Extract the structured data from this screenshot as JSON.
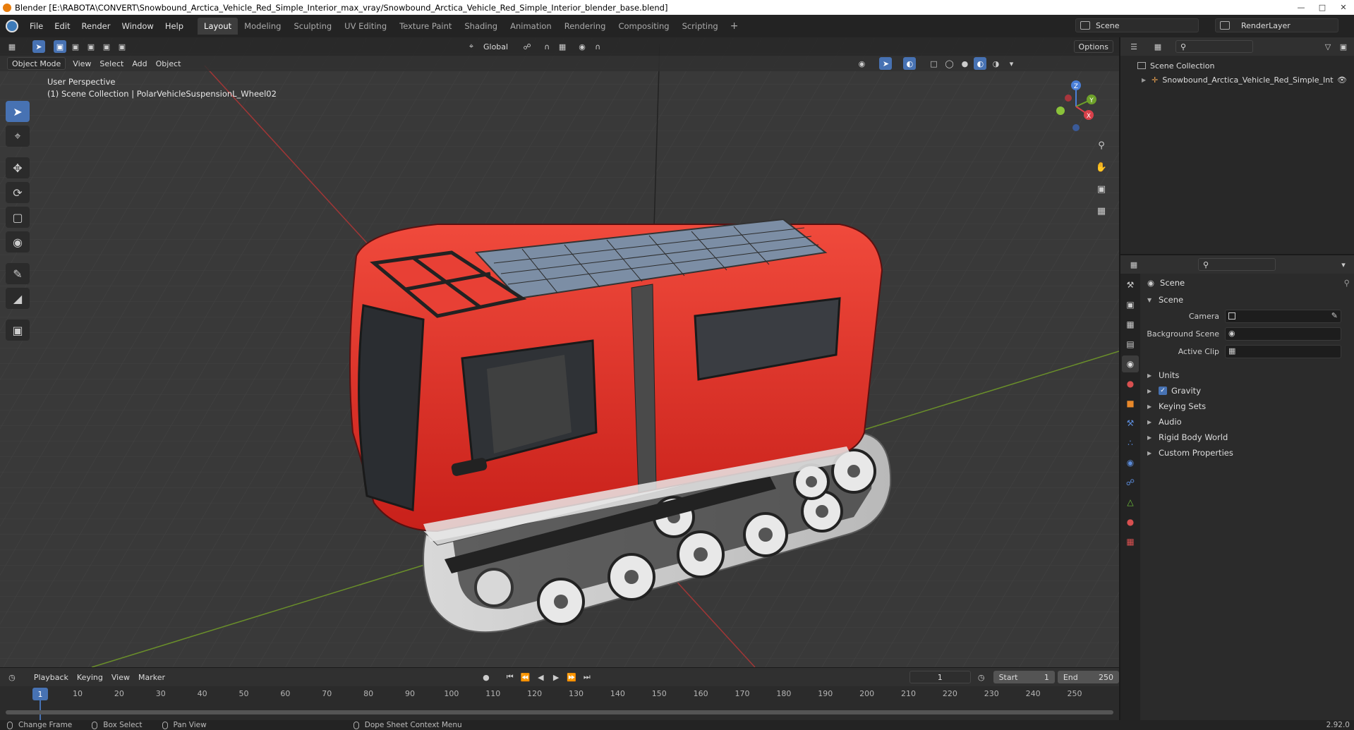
{
  "window": {
    "title": "Blender [E:\\RABOTA\\CONVERT\\Snowbound_Arctica_Vehicle_Red_Simple_Interior_max_vray/Snowbound_Arctica_Vehicle_Red_Simple_Interior_blender_base.blend]"
  },
  "menu": [
    "File",
    "Edit",
    "Render",
    "Window",
    "Help"
  ],
  "workspaces": [
    "Layout",
    "Modeling",
    "Sculpting",
    "UV Editing",
    "Texture Paint",
    "Shading",
    "Animation",
    "Rendering",
    "Compositing",
    "Scripting"
  ],
  "active_workspace": "Layout",
  "scene_name": "Scene",
  "render_layer": "RenderLayer",
  "viewport": {
    "header": {
      "orientation": "Global",
      "options": "Options"
    },
    "header2": {
      "mode": "Object Mode",
      "menus": [
        "View",
        "Select",
        "Add",
        "Object"
      ]
    },
    "info_line1": "User Perspective",
    "info_line2": "(1) Scene Collection | PolarVehicleSuspensionL_Wheel02",
    "gizmo_axes": [
      "Z",
      "Y",
      "X"
    ]
  },
  "timeline": {
    "menus": [
      "Playback",
      "Keying",
      "View",
      "Marker"
    ],
    "current_frame": "1",
    "start_label": "Start",
    "start": "1",
    "end_label": "End",
    "end": "250",
    "ticks": [
      "1",
      "10",
      "20",
      "30",
      "40",
      "50",
      "60",
      "70",
      "80",
      "90",
      "100",
      "110",
      "120",
      "130",
      "140",
      "150",
      "160",
      "170",
      "180",
      "190",
      "200",
      "210",
      "220",
      "230",
      "240",
      "250"
    ]
  },
  "statusbar": {
    "items": [
      "Change Frame",
      "Box Select",
      "Pan View",
      "Dope Sheet Context Menu"
    ],
    "version": "2.92.0"
  },
  "outliner": {
    "root": "Scene Collection",
    "child": "Snowbound_Arctica_Vehicle_Red_Simple_Int"
  },
  "properties": {
    "title": "Scene",
    "section": "Scene",
    "fields": [
      {
        "label": "Camera",
        "value": ""
      },
      {
        "label": "Background Scene",
        "value": ""
      },
      {
        "label": "Active Clip",
        "value": ""
      }
    ],
    "panels": [
      "Units",
      "Gravity",
      "Keying Sets",
      "Audio",
      "Rigid Body World",
      "Custom Properties"
    ],
    "gravity_checked": true
  },
  "colors": {
    "accent": "#4772b3",
    "vehicle_red": "#e8281e",
    "viewport_bg": "#393939"
  }
}
